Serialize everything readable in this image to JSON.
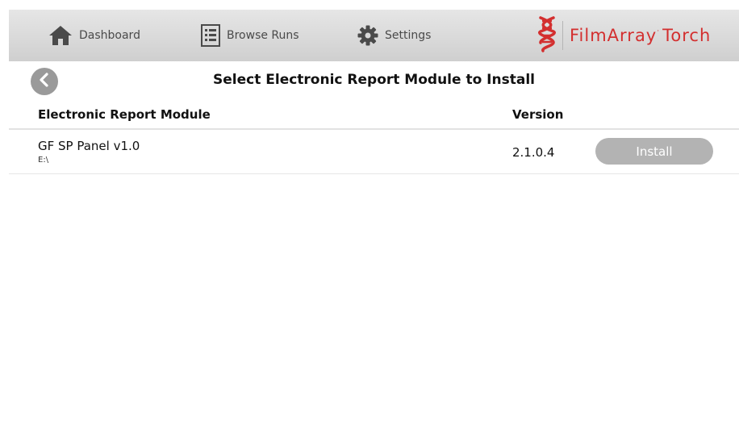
{
  "nav": {
    "dashboard": {
      "label": "Dashboard",
      "icon": "home-icon"
    },
    "browse_runs": {
      "label": "Browse Runs",
      "icon": "list-icon"
    },
    "settings": {
      "label": "Settings",
      "icon": "gear-icon"
    }
  },
  "brand": {
    "name": "FilmArray",
    "trademark": "·",
    "product": "Torch",
    "icon": "dna-helix-logo",
    "color": "#d32f2f"
  },
  "page": {
    "title": "Select Electronic Report Module to Install",
    "back_icon": "chevron-left-icon"
  },
  "table": {
    "headers": {
      "module": "Electronic Report Module",
      "version": "Version"
    },
    "rows": [
      {
        "name": "GF SP Panel v1.0",
        "path": "E:\\",
        "version": "2.1.0.4",
        "action": "Install"
      }
    ]
  },
  "colors": {
    "topbar": "#d9d9d9",
    "button_disabled": "#b3b3b3",
    "back_button": "#9a9a9a"
  }
}
